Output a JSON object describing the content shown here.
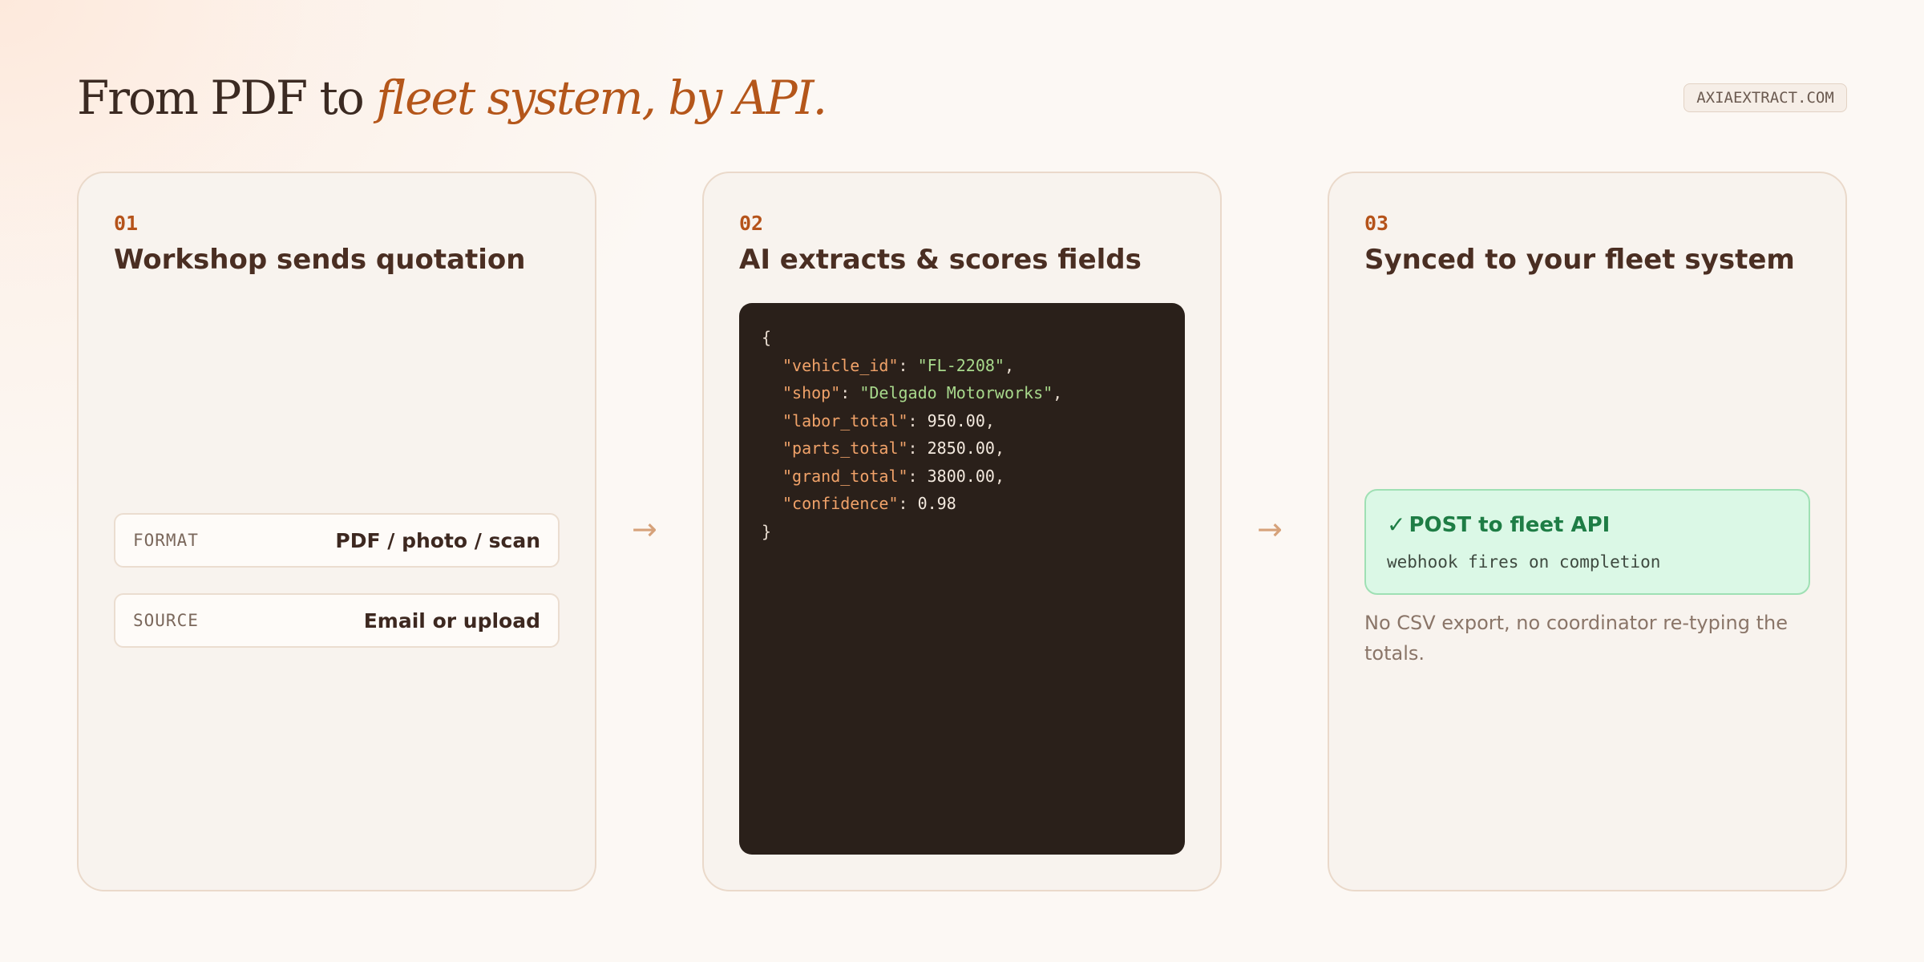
{
  "header": {
    "title_lead": "From PDF to ",
    "title_accent": "fleet system, by API.",
    "domain": "AXIAEXTRACT.COM"
  },
  "steps": [
    {
      "number": "01",
      "title": "Workshop sends quotation",
      "fields": [
        {
          "label": "FORMAT",
          "value": "PDF / photo / scan"
        },
        {
          "label": "SOURCE",
          "value": "Email or upload"
        }
      ]
    },
    {
      "number": "02",
      "title": "AI extracts & scores fields",
      "code": {
        "open": "{",
        "close": "}",
        "lines": [
          {
            "key": "\"vehicle_id\"",
            "value": "\"FL-2208\"",
            "trail": ","
          },
          {
            "key": "\"shop\"",
            "value": "\"Delgado Motorworks\"",
            "trail": ","
          },
          {
            "key": "\"labor_total\"",
            "value": "950.00",
            "trail": ","
          },
          {
            "key": "\"parts_total\"",
            "value": "2850.00",
            "trail": ","
          },
          {
            "key": "\"grand_total\"",
            "value": "3800.00",
            "trail": ","
          },
          {
            "key": "\"confidence\"",
            "value": "0.98",
            "trail": ""
          }
        ]
      }
    },
    {
      "number": "03",
      "title": "Synced to your fleet system",
      "api": {
        "check": "✓",
        "title": "POST to fleet API",
        "subtitle": "webhook fires on completion"
      },
      "note": "No CSV export, no coordinator re-typing the totals."
    }
  ],
  "arrows": [
    "→",
    "→"
  ],
  "colors": {
    "accent": "#b4561a",
    "success": "#1e7d45",
    "code_bg": "#2a201a",
    "code_key": "#f0a269",
    "code_string": "#a8d98c"
  }
}
